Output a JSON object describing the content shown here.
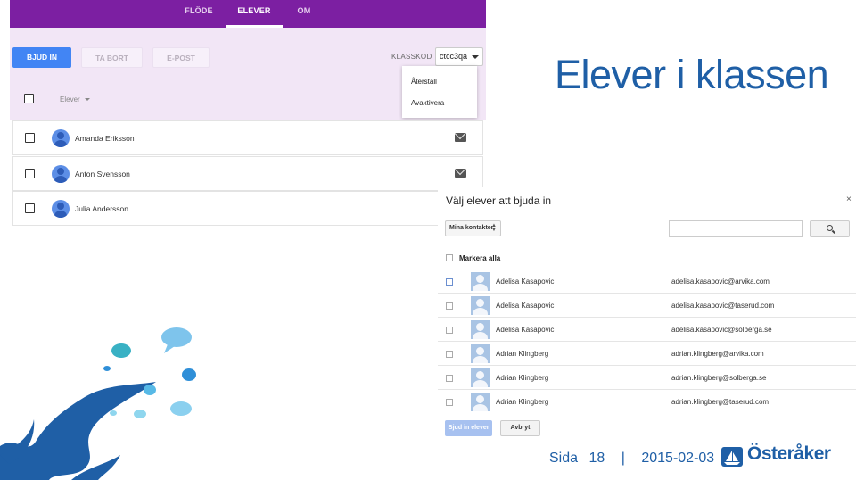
{
  "classroom": {
    "nav": {
      "tabs": [
        "FLÖDE",
        "ELEVER",
        "OM"
      ],
      "active": "ELEVER"
    },
    "actions": {
      "invite": "BJUD IN",
      "remove": "TA BORT",
      "email": "E-POST"
    },
    "class_code": {
      "label": "KLASSKOD",
      "value": "ctcc3qa"
    },
    "menu": {
      "items": [
        "Återställ",
        "Avaktivera"
      ]
    },
    "list_header": "Elever",
    "students": [
      {
        "name": "Amanda Eriksson"
      },
      {
        "name": "Anton Svensson"
      },
      {
        "name": "Julia Andersson"
      }
    ],
    "colors": {
      "nav_bg": "#7c1fa2",
      "panel_bg": "#f2e6f6",
      "primary": "#4285f4"
    }
  },
  "slide": {
    "title": "Elever i klassen",
    "footer": {
      "label": "Sida",
      "page": "18",
      "separator": "|",
      "date": "2015-02-03"
    },
    "logo_text": "Österåker"
  },
  "invite_dialog": {
    "title": "Välj elever att bjuda in",
    "close": "×",
    "contacts_select": "Mina kontakter",
    "select_all": "Markera alla",
    "rows": [
      {
        "name": "Adelisa Kasapovic",
        "email": "adelisa.kasapovic@arvika.com"
      },
      {
        "name": "Adelisa Kasapovic",
        "email": "adelisa.kasapovic@taserud.com"
      },
      {
        "name": "Adelisa Kasapovic",
        "email": "adelisa.kasapovic@solberga.se"
      },
      {
        "name": "Adrian Klingberg",
        "email": "adrian.klingberg@arvika.com"
      },
      {
        "name": "Adrian Klingberg",
        "email": "adrian.klingberg@solberga.se"
      },
      {
        "name": "Adrian Klingberg",
        "email": "adrian.klingberg@taserud.com"
      }
    ],
    "invite_button": "Bjud in elever",
    "cancel_button": "Avbryt"
  }
}
